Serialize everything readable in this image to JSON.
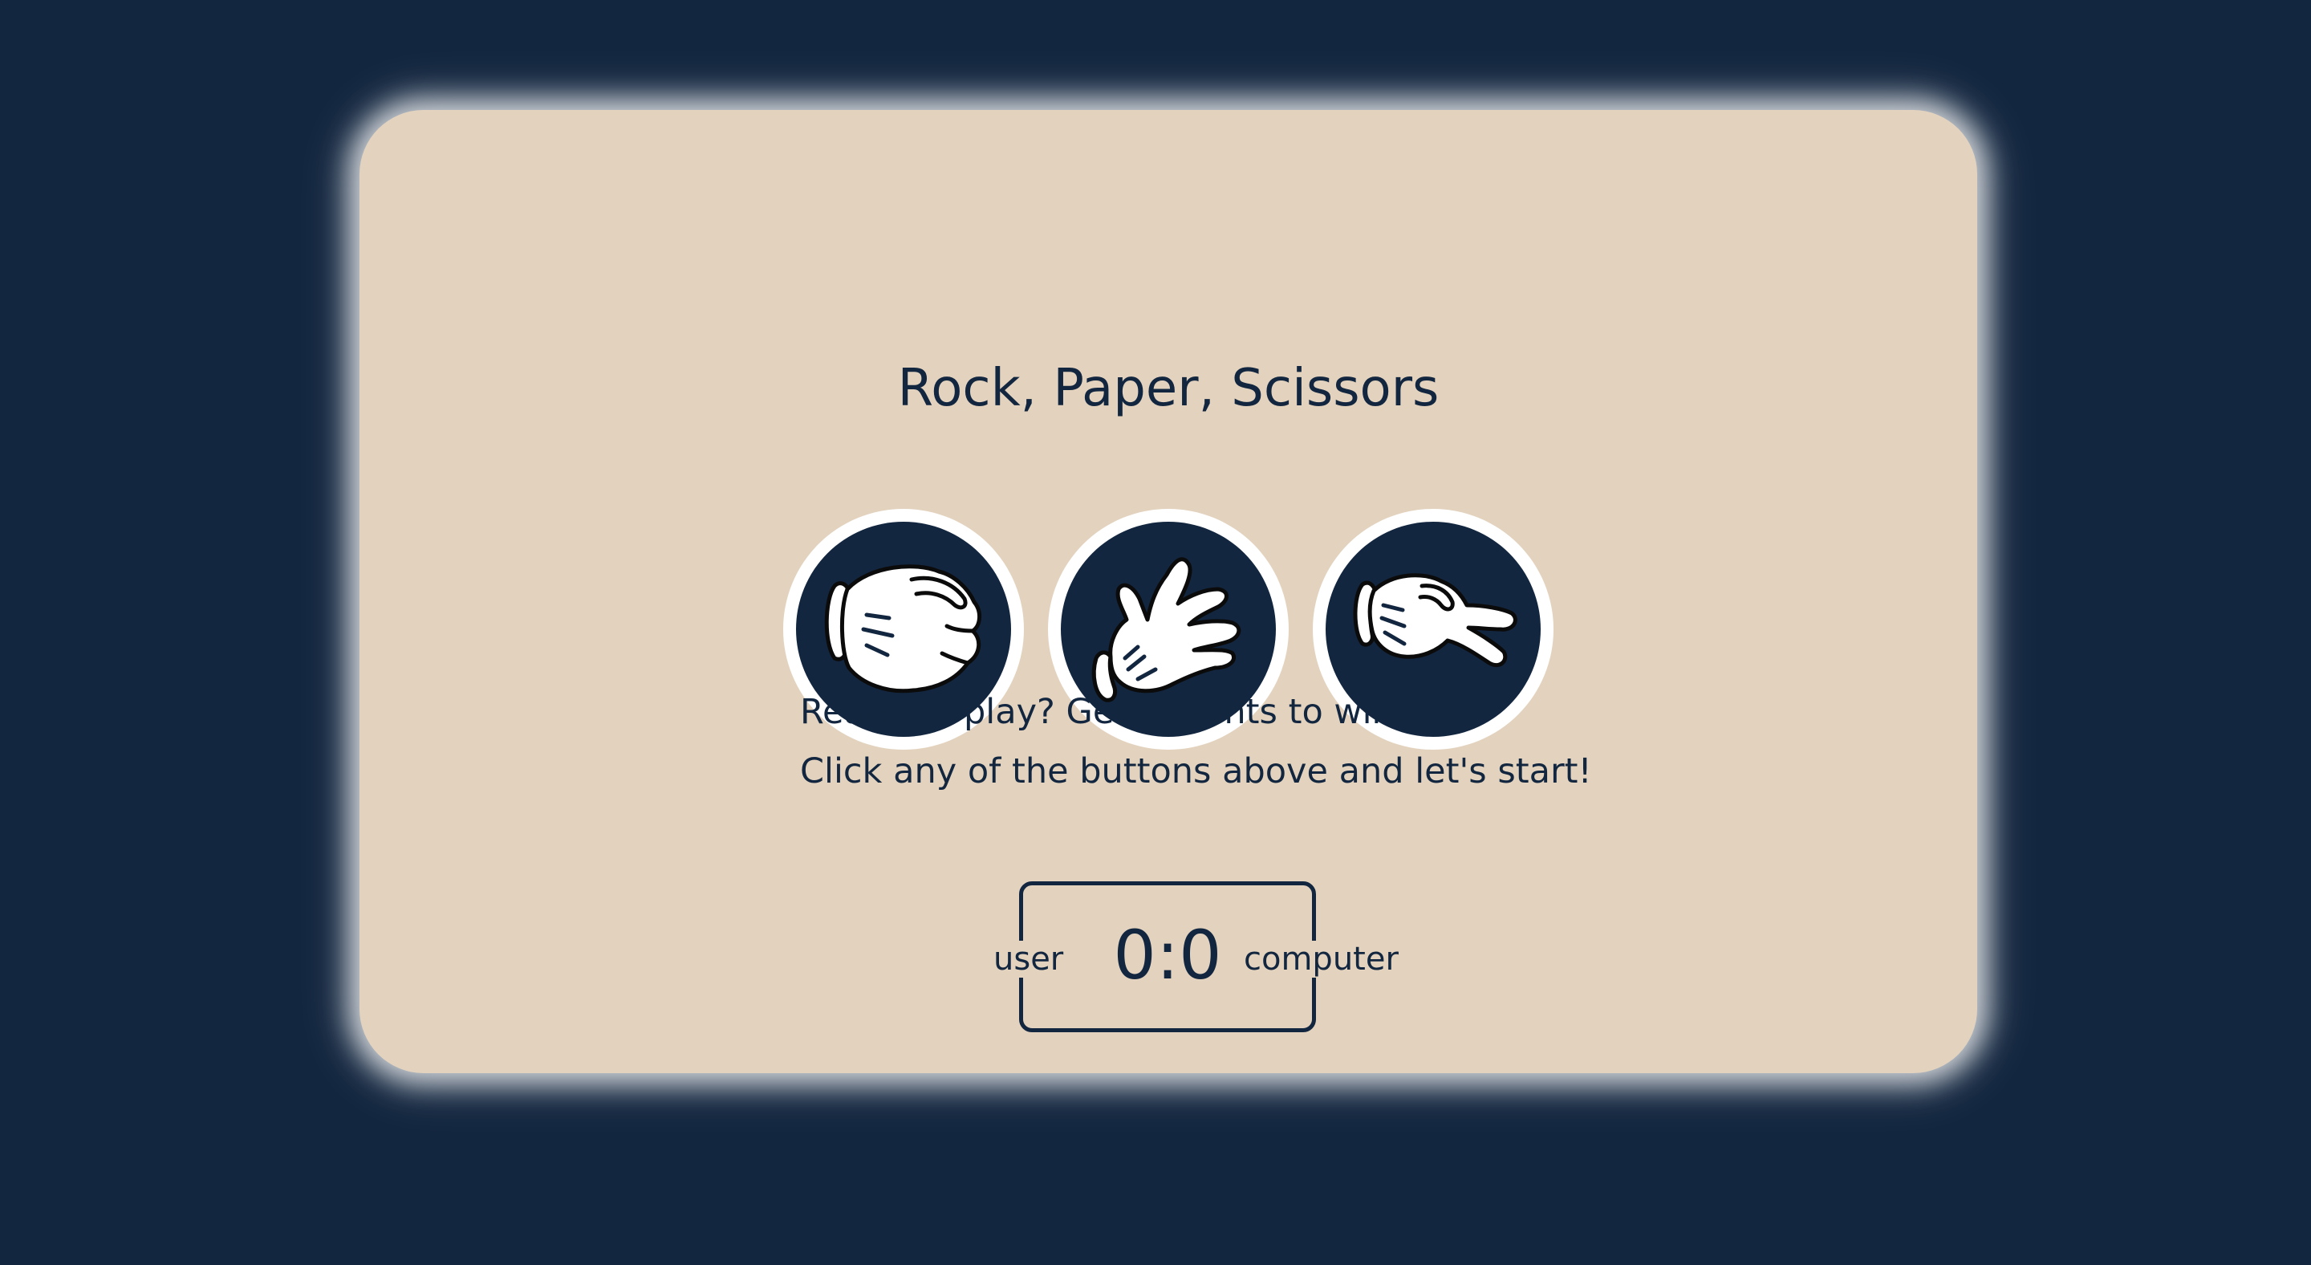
{
  "game": {
    "title": "Rock, Paper, Scissors",
    "choices": [
      {
        "name": "rock",
        "icon": "rock-fist-icon"
      },
      {
        "name": "paper",
        "icon": "paper-hand-icon"
      },
      {
        "name": "scissors",
        "icon": "scissors-hand-icon"
      }
    ],
    "message_line1": "Ready to play? Get 3 points to win.",
    "message_line2": "Click any of the buttons above and let's start!",
    "scoreboard": {
      "user_label": "user",
      "computer_label": "computer",
      "user_score": "0",
      "separator": ":",
      "computer_score": "0"
    }
  },
  "colors": {
    "background": "#13263f",
    "card": "#e3d3be",
    "accent": "#13263f",
    "ring": "#ffffff"
  }
}
